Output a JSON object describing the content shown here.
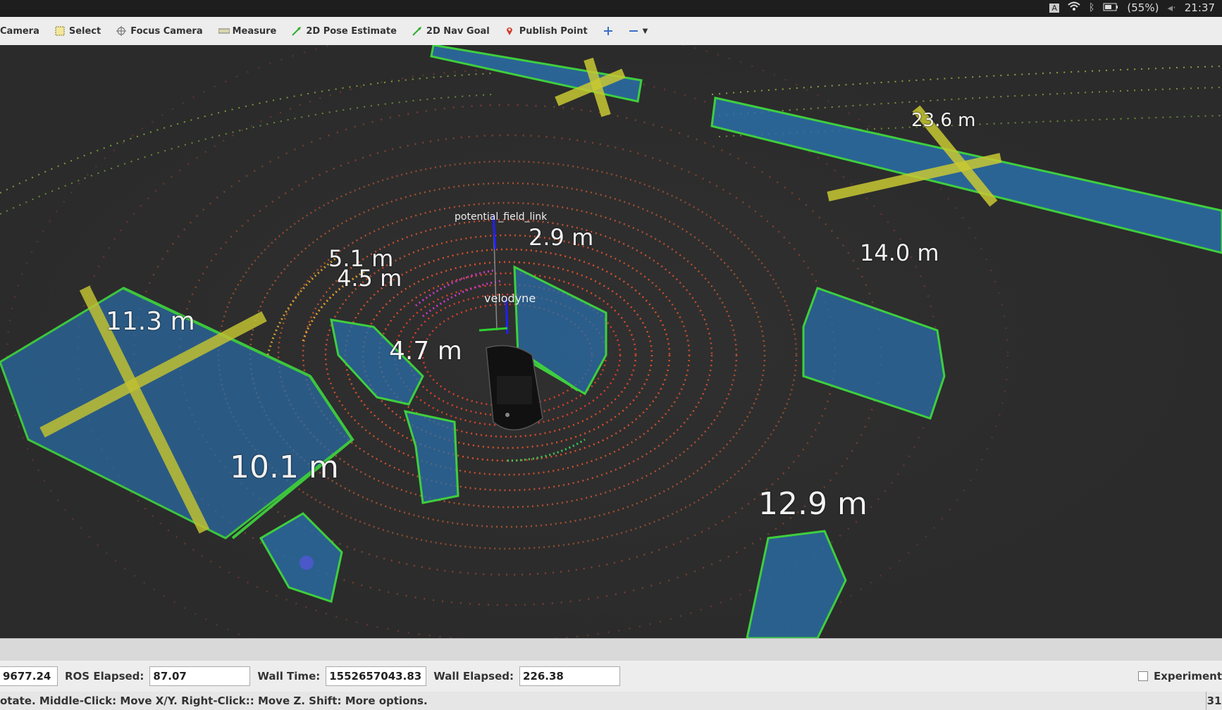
{
  "system_tray": {
    "keyboard_indicator": "A",
    "battery": "(55%)",
    "clock": "21:37"
  },
  "toolbar": {
    "tools": [
      {
        "label": "Camera",
        "icon": "camera-icon"
      },
      {
        "label": "Select",
        "icon": "select-box-icon"
      },
      {
        "label": "Focus Camera",
        "icon": "focus-camera-icon"
      },
      {
        "label": "Measure",
        "icon": "ruler-icon"
      },
      {
        "label": "2D Pose Estimate",
        "icon": "green-arrow-icon"
      },
      {
        "label": "2D Nav Goal",
        "icon": "green-arrow-icon"
      },
      {
        "label": "Publish Point",
        "icon": "map-pin-icon"
      }
    ]
  },
  "viewport": {
    "frame_labels": {
      "potential_field": "potential_field_link",
      "velodyne": "velodyne"
    },
    "distance_labels": [
      {
        "text": "23.6  m"
      },
      {
        "text": "14.0  m"
      },
      {
        "text": "2.9  m"
      },
      {
        "text": "5.1  m"
      },
      {
        "text": "4.5  m"
      },
      {
        "text": "11.3  m"
      },
      {
        "text": "4.7  m"
      },
      {
        "text": "10.1  m"
      },
      {
        "text": "12.9  m"
      }
    ],
    "colors": {
      "background": "#2f2f2f",
      "box_fill": "#2a6ea8",
      "box_edge": "#3ecf3e",
      "cross": "#c8c832",
      "near_points": "#d8402a"
    }
  },
  "time_panel": {
    "ros_time_value": "9677.24",
    "ros_elapsed_label": "ROS Elapsed:",
    "ros_elapsed_value": "87.07",
    "wall_time_label": "Wall Time:",
    "wall_time_value": "1552657043.83",
    "wall_elapsed_label": "Wall Elapsed:",
    "wall_elapsed_value": "226.38",
    "experimental_label": "Experiment"
  },
  "status_bar": {
    "hint": "otate. Middle-Click: Move X/Y. Right-Click:: Move Z. Shift: More options.",
    "fps": "31"
  }
}
